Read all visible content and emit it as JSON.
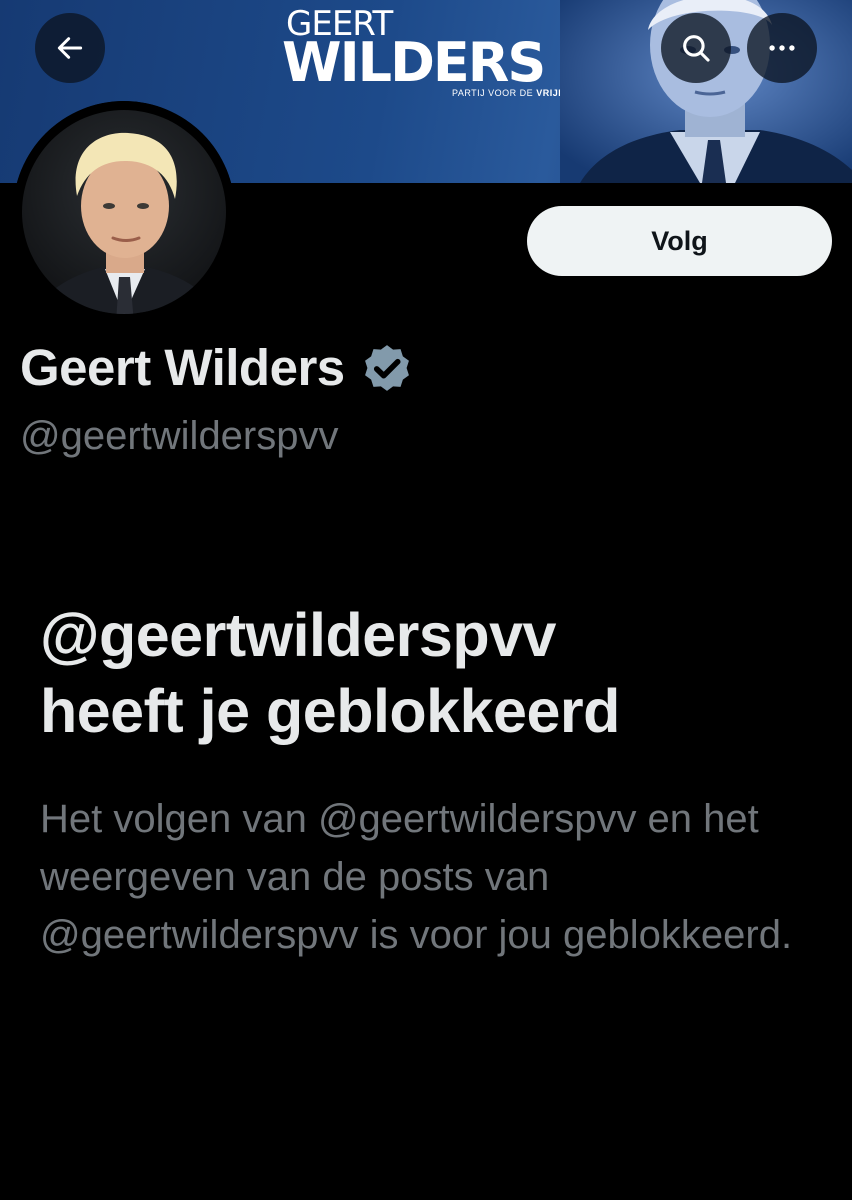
{
  "banner": {
    "logo_line1": "GEERT",
    "logo_line2": "WILDERS",
    "logo_sub_prefix": "PARTIJ VOOR DE ",
    "logo_sub_bold": "VRIJHEID"
  },
  "nav": {
    "back_icon": "arrow-left-icon",
    "search_icon": "search-icon",
    "more_icon": "more-horizontal-icon"
  },
  "profile": {
    "display_name": "Geert Wilders",
    "handle": "@geertwilderspvv",
    "verified_icon": "verified-badge-icon",
    "follow_label": "Volg"
  },
  "blocked": {
    "title_line1": "@geertwilderspvv",
    "title_line2": "heeft je geblokkeerd",
    "description": "Het volgen van @geertwilderspvv en het weergeven van de posts van @geertwilderspvv is voor jou geblokkeerd."
  },
  "colors": {
    "background": "#000000",
    "primary_text": "#e7e9ea",
    "secondary_text": "#71767b",
    "follow_button_bg": "#eff3f4",
    "banner_blue": "#1d4a8a",
    "verified_badge": "#829aab"
  }
}
